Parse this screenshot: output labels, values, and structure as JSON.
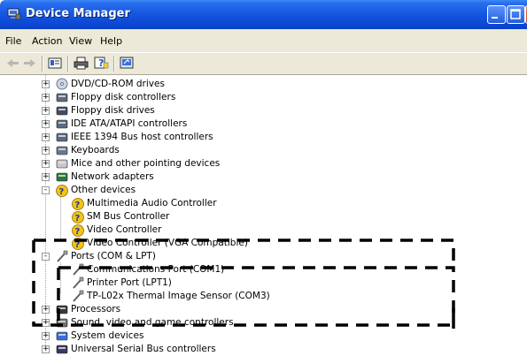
{
  "window": {
    "title": "Device Manager"
  },
  "menu": [
    "File",
    "Action",
    "View",
    "Help"
  ],
  "toolbar_icons": [
    "back-arrow-icon",
    "forward-arrow-icon",
    "properties-icon",
    "print-icon",
    "help-icon",
    "refresh-icon"
  ],
  "tree": {
    "items": [
      {
        "label": "DVD/CD-ROM drives",
        "icon": "dvd-drive-icon",
        "expander": "+"
      },
      {
        "label": "Floppy disk controllers",
        "icon": "floppy-controller-icon",
        "expander": "+"
      },
      {
        "label": "Floppy disk drives",
        "icon": "floppy-drive-icon",
        "expander": "+"
      },
      {
        "label": "IDE ATA/ATAPI controllers",
        "icon": "ide-controller-icon",
        "expander": "+"
      },
      {
        "label": "IEEE 1394 Bus host controllers",
        "icon": "ieee1394-icon",
        "expander": "+"
      },
      {
        "label": "Keyboards",
        "icon": "keyboard-icon",
        "expander": "+"
      },
      {
        "label": "Mice and other pointing devices",
        "icon": "mouse-icon",
        "expander": "+"
      },
      {
        "label": "Network adapters",
        "icon": "network-adapter-icon",
        "expander": "+"
      },
      {
        "label": "Other devices",
        "icon": "unknown-device-icon",
        "expander": "-"
      },
      {
        "label": "Multimedia Audio Controller",
        "icon": "unknown-device-icon",
        "expander": ""
      },
      {
        "label": "SM Bus Controller",
        "icon": "unknown-device-icon",
        "expander": ""
      },
      {
        "label": "Video Controller",
        "icon": "unknown-device-icon",
        "expander": ""
      },
      {
        "label": "Video Controller (VGA Compatible)",
        "icon": "unknown-device-icon",
        "expander": ""
      },
      {
        "label": "Ports (COM & LPT)",
        "icon": "port-icon",
        "expander": "-"
      },
      {
        "label": "Communications Port (COM1)",
        "icon": "port-icon",
        "expander": ""
      },
      {
        "label": "Printer Port (LPT1)",
        "icon": "port-icon",
        "expander": ""
      },
      {
        "label": "TP-L02x Thermal Image Sensor (COM3)",
        "icon": "port-icon",
        "expander": ""
      },
      {
        "label": "Processors",
        "icon": "processor-icon",
        "expander": "+"
      },
      {
        "label": "Sound, video and game controllers",
        "icon": "sound-icon",
        "expander": "+"
      },
      {
        "label": "System devices",
        "icon": "system-device-icon",
        "expander": "+"
      },
      {
        "label": "Universal Serial Bus controllers",
        "icon": "usb-icon",
        "expander": "+"
      }
    ]
  }
}
